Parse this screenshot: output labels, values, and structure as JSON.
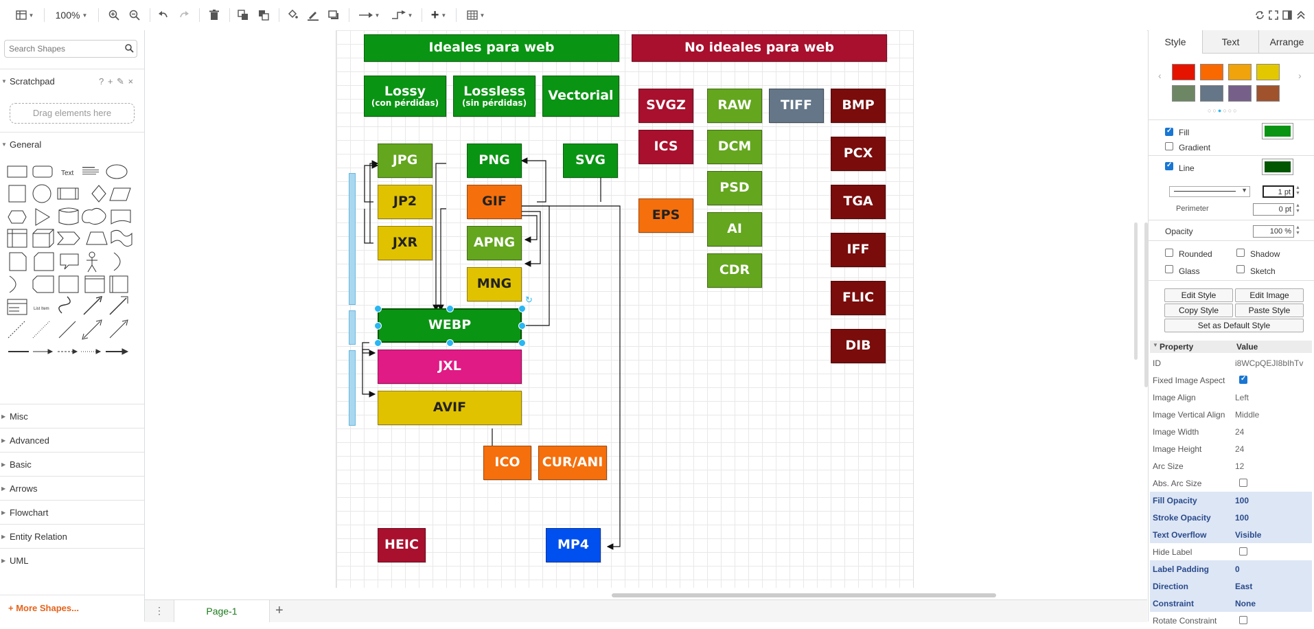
{
  "toolbar": {
    "zoom": "100%",
    "icons": [
      "sidebar-toggle-icon",
      "zoom-in-icon",
      "zoom-out-icon",
      "undo-icon",
      "redo-icon",
      "delete-icon",
      "to-front-icon",
      "to-back-icon",
      "fill-color-icon",
      "line-color-icon",
      "shadow-icon",
      "connection-icon",
      "waypoints-icon",
      "insert-icon",
      "table-icon"
    ]
  },
  "sidebar": {
    "search_placeholder": "Search Shapes",
    "scratchpad": "Scratchpad",
    "scratchpad_actions": "? + ✎ ×",
    "drag_hint": "Drag elements here",
    "general": "General",
    "shape_text_labels": [
      "Text",
      "List Item"
    ],
    "sections": [
      "Misc",
      "Advanced",
      "Basic",
      "Arrows",
      "Flowchart",
      "Entity Relation",
      "UML"
    ],
    "more_shapes": "+ More Shapes..."
  },
  "diagram": {
    "headers": [
      {
        "label": "Ideales para web",
        "color": "#0a9413"
      },
      {
        "label": "No ideales para web",
        "color": "#a8102e"
      }
    ],
    "categories": [
      {
        "label": "Lossy",
        "sub": "(con pérdidas)"
      },
      {
        "label": "Lossless",
        "sub": "(sin pérdidas)"
      },
      {
        "label": "Vectorial",
        "sub": ""
      }
    ],
    "formats": {
      "jpg": "JPG",
      "jp2": "JP2",
      "jxr": "JXR",
      "png": "PNG",
      "gif": "GIF",
      "apng": "APNG",
      "mng": "MNG",
      "svg": "SVG",
      "webp": "WEBP",
      "jxl": "JXL",
      "avif": "AVIF",
      "ico": "ICO",
      "curani": "CUR/ANI",
      "heic": "HEIC",
      "mp4": "MP4",
      "svgz": "SVGZ",
      "ics": "ICS",
      "eps": "EPS",
      "raw": "RAW",
      "dcm": "DCM",
      "psd": "PSD",
      "ai": "AI",
      "cdr": "CDR",
      "tiff": "TIFF",
      "bmp": "BMP",
      "pcx": "PCX",
      "tga": "TGA",
      "iff": "IFF",
      "flic": "FLIC",
      "dib": "DIB"
    },
    "colors": {
      "green": "#0a9413",
      "lightgreen": "#64a61e",
      "yellow": "#e0c200",
      "orange": "#f56f0c",
      "magenta": "#e01b85",
      "darkred": "#7a0c0c",
      "crimson": "#a8102e",
      "slate": "#647687",
      "blue": "#0050ef"
    }
  },
  "bottom": {
    "page_tab": "Page-1"
  },
  "panel": {
    "tabs": [
      "Style",
      "Text",
      "Arrange"
    ],
    "swatches": [
      "#e51400",
      "#fa6800",
      "#f0a30a",
      "#e3c800",
      "#6d8764",
      "#647687",
      "#76608a",
      "#a0522d"
    ],
    "fill_label": "Fill",
    "fill_color": "#0a9413",
    "gradient_label": "Gradient",
    "line_label": "Line",
    "line_color": "#005700",
    "line_width": "1 pt",
    "perimeter_label": "Perimeter",
    "perimeter": "0 pt",
    "opacity_label": "Opacity",
    "opacity": "100 %",
    "rounded": "Rounded",
    "shadow": "Shadow",
    "glass": "Glass",
    "sketch": "Sketch",
    "edit_style": "Edit Style",
    "edit_image": "Edit Image",
    "copy_style": "Copy Style",
    "paste_style": "Paste Style",
    "set_default": "Set as Default Style",
    "prop_header": "Property",
    "value_header": "Value",
    "properties": [
      {
        "k": "ID",
        "v": "i8WCpQEJI8bIhTv"
      },
      {
        "k": "Fixed Image Aspect",
        "v": ""
      },
      {
        "k": "Image Align",
        "v": "Left"
      },
      {
        "k": "Image Vertical Align",
        "v": "Middle"
      },
      {
        "k": "Image Width",
        "v": "24"
      },
      {
        "k": "Image Height",
        "v": "24"
      },
      {
        "k": "Arc Size",
        "v": "12"
      },
      {
        "k": "Abs. Arc Size",
        "v": ""
      },
      {
        "k": "Fill Opacity",
        "v": "100"
      },
      {
        "k": "Stroke Opacity",
        "v": "100"
      },
      {
        "k": "Text Overflow",
        "v": "Visible"
      },
      {
        "k": "Hide Label",
        "v": ""
      },
      {
        "k": "Label Padding",
        "v": "0"
      },
      {
        "k": "Direction",
        "v": "East"
      },
      {
        "k": "Constraint",
        "v": "None"
      },
      {
        "k": "Rotate Constraint",
        "v": ""
      }
    ]
  }
}
